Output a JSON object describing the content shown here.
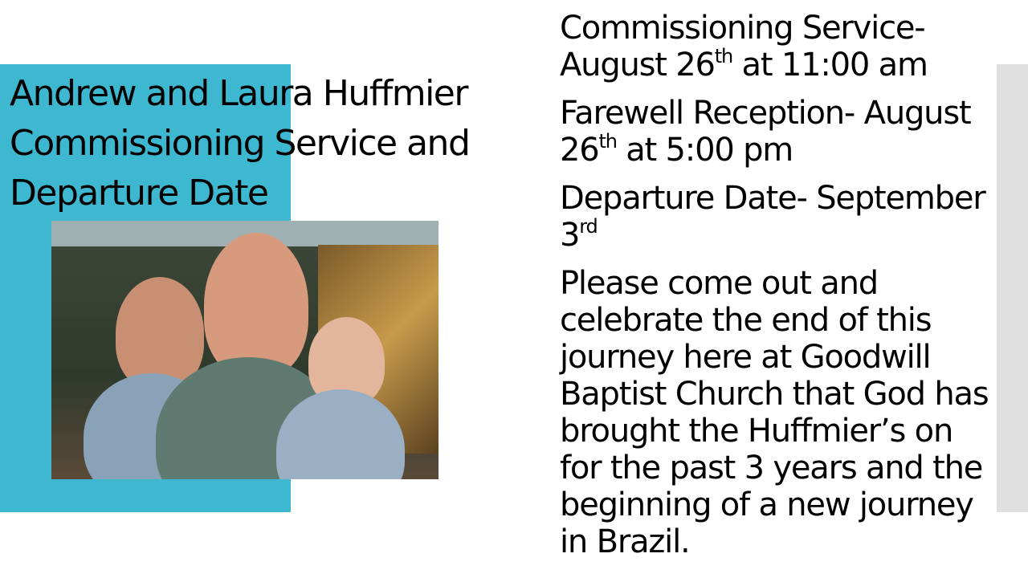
{
  "title_lines": [
    "Andrew and Laura Huffmier",
    "Commissioning Service and",
    "Departure Date"
  ],
  "photo_alt": "Family photo",
  "events": [
    {
      "l1": "Commissioning Service-",
      "l2a": "August 26",
      "l2sup": "th",
      "l2b": " at 11:00 am"
    },
    {
      "l1": "Farewell Reception- August",
      "l2a": "26",
      "l2sup": "th",
      "l2b": " at 5:00 pm"
    },
    {
      "l1": "Departure Date- September",
      "l2a": "3",
      "l2sup": "rd",
      "l2b": ""
    }
  ],
  "message_lines": [
    "Please come out and",
    "celebrate the end of this",
    "journey here at Goodwill",
    "Baptist Church that God has",
    "brought the Huffmier’s on",
    "for the past 3 years and the",
    "beginning of a new journey",
    "in Brazil."
  ],
  "colors": {
    "accent": "#3eb8d1",
    "side_bar": "#e0e0e0"
  }
}
